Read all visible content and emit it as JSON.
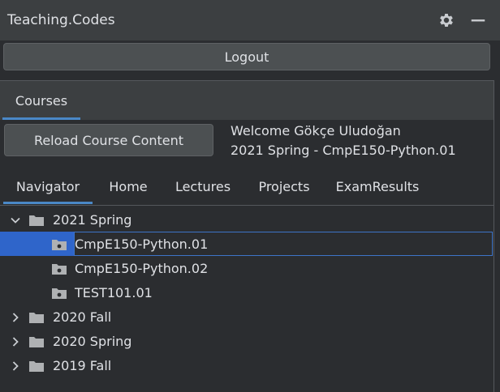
{
  "window": {
    "title": "Teaching.Codes"
  },
  "header": {
    "logout_label": "Logout"
  },
  "courses_tab": {
    "label": "Courses"
  },
  "toolbar": {
    "reload_label": "Reload Course Content",
    "welcome": "Welcome Gökçe Uludoğan",
    "semester_course": "2021 Spring - CmpE150-Python.01"
  },
  "nav": {
    "tabs": [
      {
        "label": "Navigator",
        "active": true
      },
      {
        "label": "Home"
      },
      {
        "label": "Lectures"
      },
      {
        "label": "Projects"
      },
      {
        "label": "ExamResults"
      }
    ]
  },
  "tree": [
    {
      "label": "2021 Spring",
      "type": "folder",
      "expanded": true,
      "children": [
        {
          "label": "CmpE150-Python.01",
          "type": "package",
          "selected": true
        },
        {
          "label": "CmpE150-Python.02",
          "type": "package"
        },
        {
          "label": "TEST101.01",
          "type": "package"
        }
      ]
    },
    {
      "label": "2020 Fall",
      "type": "folder",
      "expanded": false
    },
    {
      "label": "2020 Spring",
      "type": "folder",
      "expanded": false
    },
    {
      "label": "2019 Fall",
      "type": "folder",
      "expanded": false
    }
  ],
  "colors": {
    "accent": "#4a88c7",
    "selection": "#2f65ca",
    "background": "#2b2d30",
    "toolbar": "#3c3f41"
  },
  "icons": [
    "gear-icon",
    "minimize-icon",
    "chevron-down-icon",
    "chevron-right-icon",
    "folder-icon",
    "package-icon"
  ]
}
